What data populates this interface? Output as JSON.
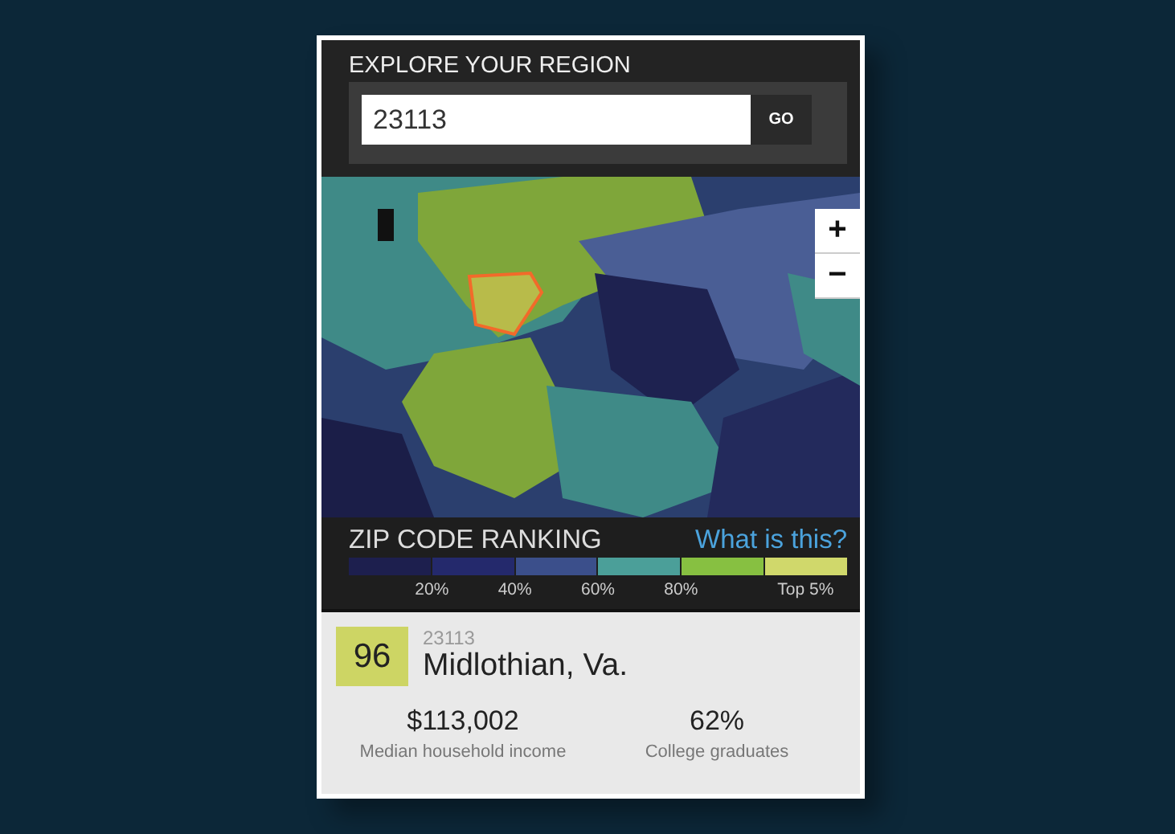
{
  "search": {
    "title": "EXPLORE YOUR REGION",
    "value": "23113",
    "button": "GO"
  },
  "map": {
    "kind": "picture",
    "zoom_controls": [
      "+",
      "−"
    ]
  },
  "legend": {
    "title": "ZIP CODE RANKING",
    "link": "What is this?",
    "segments": [
      {
        "color": "#1d1f4e"
      },
      {
        "color": "#24296c"
      },
      {
        "color": "#3b4f8b"
      },
      {
        "color": "#4b9f99"
      },
      {
        "color": "#87c041"
      },
      {
        "color": "#d0d86b"
      }
    ],
    "ticks": [
      {
        "label": "20%",
        "kind": "boundary"
      },
      {
        "label": "40%",
        "kind": "boundary"
      },
      {
        "label": "60%",
        "kind": "boundary"
      },
      {
        "label": "80%",
        "kind": "boundary"
      },
      {
        "label": "Top 5%",
        "kind": "end"
      }
    ]
  },
  "result": {
    "score": "96",
    "zip": "23113",
    "place": "Midlothian, Va.",
    "stats": [
      {
        "value": "$113,002",
        "label": "Median household income"
      },
      {
        "value": "62%",
        "label": "College graduates"
      }
    ]
  }
}
